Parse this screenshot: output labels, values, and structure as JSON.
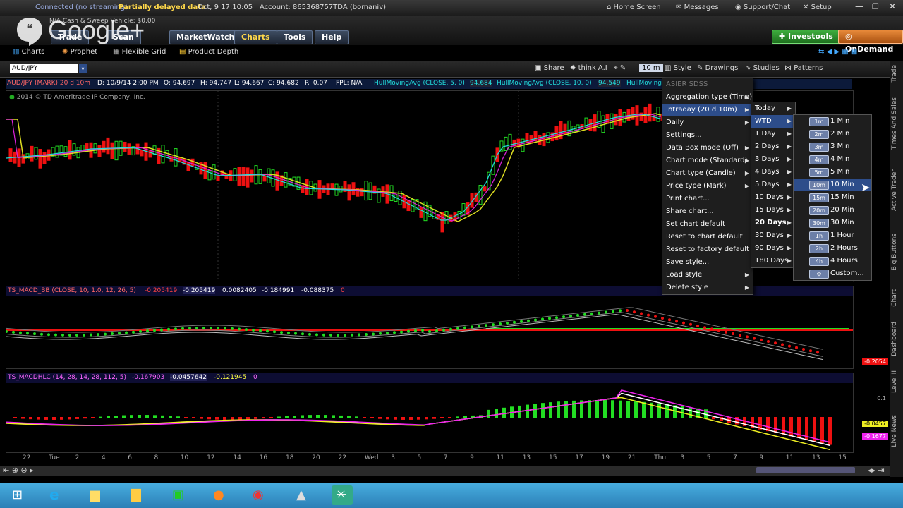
{
  "topbar": {
    "connected": "Connected (no streaming)",
    "delayed": "Partially delayed data",
    "datetime": "Oct, 9  17:10:05",
    "account": "Account: 865368757TDA (bomaniv)",
    "home": "Home Screen",
    "messages": "Messages",
    "support": "Support/Chat",
    "setup": "Setup"
  },
  "branding": {
    "logo_text": "Google+",
    "cash_label": "N/A",
    "cash_sweep": "Cash & Sweep Vehicle: $0.00"
  },
  "menubar": {
    "items": [
      "Trade",
      "Scan",
      "MarketWatch",
      "Charts",
      "Tools",
      "Help"
    ],
    "investools": "Investools",
    "ondemand": "OnDemand"
  },
  "subtabs": [
    "Charts",
    "Prophet",
    "Flexible Grid",
    "Product Depth"
  ],
  "toolbar": {
    "symbol": "AUD/JPY",
    "share": "Share",
    "think": "think A.I",
    "tf": "10 m",
    "style": "Style",
    "drawings": "Drawings",
    "studies": "Studies",
    "patterns": "Patterns"
  },
  "infobar": {
    "symbol": "AUD/JPY (MARK) 20 d 10m",
    "date": "D: 10/9/14 2:00 PM",
    "open": "O: 94.697",
    "high": "H: 94.747",
    "low": "L: 94.667",
    "close": "C: 94.682",
    "range": "R: 0.07",
    "fpl": "FPL: N/A",
    "hma1": "HullMovingAvg (CLOSE, 5, 0)",
    "hma1_val": "94.684",
    "hma2": "HullMovingAvg (CLOSE, 10, 0)",
    "hma2_val": "94.549",
    "hma3": "HullMoving"
  },
  "copyright": "2014 © TD Ameritrade IP Company, Inc.",
  "macd_bb": {
    "title": "TS_MACD_BB (CLOSE, 10, 1.0, 12, 26, 5)",
    "v1": "-0.205419",
    "v2": "-0.205419",
    "v3": "0.0082405",
    "v4": "-0.184991",
    "v5": "-0.088375",
    "v6": "0",
    "axis_label": "-0.2054"
  },
  "macd_hlc": {
    "title": "TS_MACDHLC (14, 28, 14, 28, 112, 5)",
    "v1": "-0.167903",
    "v2": "-0.0457642",
    "v3": "-0.121945",
    "v4": "0",
    "axis_label1": "-0.0457",
    "axis_label2": "-0.1677",
    "axis_tick": "0.1"
  },
  "xaxis": [
    "22",
    "Tue",
    "2",
    "4",
    "6",
    "8",
    "10",
    "12",
    "14",
    "16",
    "18",
    "20",
    "22",
    "Wed",
    "3",
    "5",
    "7",
    "9",
    "11",
    "13",
    "15",
    "17",
    "19",
    "21",
    "Thu",
    "3",
    "5",
    "7",
    "9",
    "11",
    "13",
    "15"
  ],
  "right_tabs": [
    "Trade",
    "Times And Sales",
    "Active Trader",
    "Big Buttons",
    "Chart",
    "Dashboard",
    "Level II",
    "Live News"
  ],
  "style_menu": [
    {
      "label": "ASIER SDSS",
      "dim": true
    },
    {
      "label": "Aggregation type (Time)",
      "arrow": true
    },
    {
      "label": "Intraday (20 d 10m)",
      "arrow": true,
      "highlight": true
    },
    {
      "label": "Daily",
      "arrow": true
    },
    {
      "label": "Settings..."
    },
    {
      "label": "Data Box mode (Off)",
      "arrow": true
    },
    {
      "label": "Chart mode (Standard)",
      "arrow": true
    },
    {
      "label": "Chart type (Candle)",
      "arrow": true
    },
    {
      "label": "Price type (Mark)",
      "arrow": true
    },
    {
      "label": "Print chart..."
    },
    {
      "label": "Share chart..."
    },
    {
      "label": "Set chart default"
    },
    {
      "label": "Reset to chart default"
    },
    {
      "label": "Reset to factory default"
    },
    {
      "label": "Save style..."
    },
    {
      "label": "Load style",
      "arrow": true
    },
    {
      "label": "Delete style",
      "arrow": true
    }
  ],
  "range_menu": [
    {
      "label": "Today",
      "arrow": true
    },
    {
      "label": "WTD",
      "arrow": true,
      "highlight": true
    },
    {
      "label": "1 Day",
      "arrow": true
    },
    {
      "label": "2 Days",
      "arrow": true
    },
    {
      "label": "3 Days",
      "arrow": true
    },
    {
      "label": "4 Days",
      "arrow": true
    },
    {
      "label": "5 Days",
      "arrow": true
    },
    {
      "label": "10 Days",
      "arrow": true
    },
    {
      "label": "15 Days",
      "arrow": true
    },
    {
      "label": "20 Days",
      "arrow": true,
      "bold": true
    },
    {
      "label": "30 Days",
      "arrow": true
    },
    {
      "label": "90 Days",
      "arrow": true
    },
    {
      "label": "180 Days",
      "arrow": true
    }
  ],
  "interval_menu": [
    {
      "chip": "1m",
      "label": "1 Min"
    },
    {
      "chip": "2m",
      "label": "2 Min"
    },
    {
      "chip": "3m",
      "label": "3 Min"
    },
    {
      "chip": "4m",
      "label": "4 Min"
    },
    {
      "chip": "5m",
      "label": "5 Min"
    },
    {
      "chip": "10m",
      "label": "10 Min",
      "highlight": true
    },
    {
      "chip": "15m",
      "label": "15 Min"
    },
    {
      "chip": "20m",
      "label": "20 Min"
    },
    {
      "chip": "30m",
      "label": "30 Min"
    },
    {
      "chip": "1h",
      "label": "1 Hour"
    },
    {
      "chip": "2h",
      "label": "2 Hours"
    },
    {
      "chip": "4h",
      "label": "4 Hours"
    },
    {
      "chip": "",
      "label": "Custom..."
    }
  ],
  "colors": {
    "bull": "#22dd22",
    "bear": "#ee1111",
    "hma_cyan": "#22dddd",
    "hma_yellow": "#dddd22",
    "hma_magenta": "#dd22dd",
    "menu_hl": "#2d4d8a"
  }
}
